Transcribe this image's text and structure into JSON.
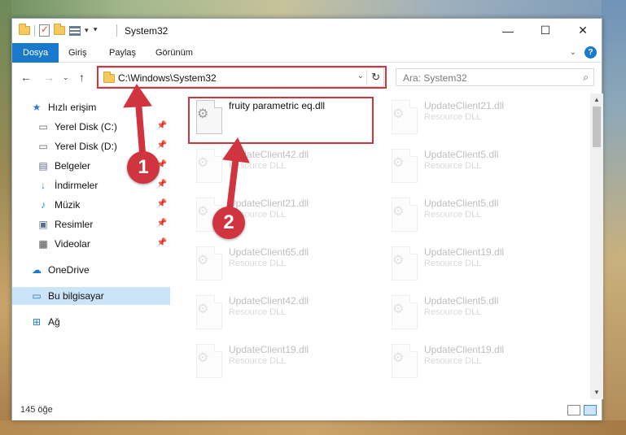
{
  "window": {
    "title": "System32",
    "controls": {
      "minimize": "—",
      "maximize": "☐",
      "close": "✕"
    }
  },
  "ribbon": {
    "tabs": [
      {
        "label": "Dosya",
        "active": true
      },
      {
        "label": "Giriş"
      },
      {
        "label": "Paylaş"
      },
      {
        "label": "Görünüm"
      }
    ],
    "help": "?"
  },
  "navigation": {
    "address": "C:\\Windows\\System32",
    "search_placeholder": "Ara: System32"
  },
  "sidebar": {
    "items": [
      {
        "label": "Hızlı erişim",
        "icon": "star-icon",
        "pinned": false
      },
      {
        "label": "Yerel Disk (C:)",
        "icon": "drive-icon",
        "pinned": true
      },
      {
        "label": "Yerel Disk (D:)",
        "icon": "drive-icon",
        "pinned": true
      },
      {
        "label": "Belgeler",
        "icon": "documents-icon",
        "pinned": true
      },
      {
        "label": "İndirmeler",
        "icon": "download-icon",
        "pinned": true
      },
      {
        "label": "Müzik",
        "icon": "music-icon",
        "pinned": true
      },
      {
        "label": "Resimler",
        "icon": "pictures-icon",
        "pinned": true
      },
      {
        "label": "Videolar",
        "icon": "video-icon",
        "pinned": true
      },
      {
        "label": "OneDrive",
        "icon": "cloud-icon",
        "pinned": false
      },
      {
        "label": "Bu bilgisayar",
        "icon": "computer-icon",
        "pinned": false,
        "selected": true
      },
      {
        "label": "Ağ",
        "icon": "network-icon",
        "pinned": false
      }
    ]
  },
  "files": [
    {
      "name": "fruity parametric eq.dll",
      "type": "",
      "highlighted": true
    },
    {
      "name": "UpdateClient21.dll",
      "type": "Resource DLL"
    },
    {
      "name": "UpdateClient42.dll",
      "type": "Resource DLL"
    },
    {
      "name": "UpdateClient5.dll",
      "type": "Resource DLL"
    },
    {
      "name": "UpdateClient21.dll",
      "type": "Resource DLL"
    },
    {
      "name": "UpdateClient5.dll",
      "type": "Resource DLL"
    },
    {
      "name": "UpdateClient65.dll",
      "type": "Resource DLL"
    },
    {
      "name": "UpdateClient19.dll",
      "type": "Resource DLL"
    },
    {
      "name": "UpdateClient42.dll",
      "type": "Resource DLL"
    },
    {
      "name": "UpdateClient5.dll",
      "type": "Resource DLL"
    },
    {
      "name": "UpdateClient19.dll",
      "type": "Resource DLL"
    },
    {
      "name": "UpdateClient19.dll",
      "type": "Resource DLL"
    }
  ],
  "status": {
    "item_count": "145 öğe"
  },
  "annotations": {
    "step1": "1",
    "step2": "2",
    "color": "#d0353f"
  }
}
